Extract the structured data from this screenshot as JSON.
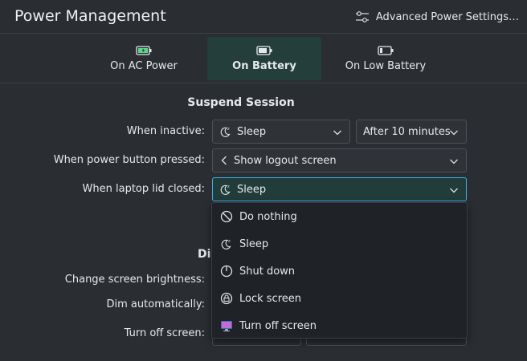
{
  "header": {
    "title": "Power Management",
    "advanced_label": "Advanced Power Settings…"
  },
  "tabs": [
    {
      "label": "On AC Power",
      "icon": "battery-charging-icon"
    },
    {
      "label": "On Battery",
      "icon": "battery-icon",
      "active": true
    },
    {
      "label": "On Low Battery",
      "icon": "battery-low-icon"
    }
  ],
  "suspend": {
    "section_title": "Suspend Session",
    "when_inactive_label": "When inactive:",
    "when_inactive_value": "Sleep",
    "after_value": "After 10 minutes",
    "power_button_label": "When power button pressed:",
    "power_button_value": "Show logout screen",
    "lid_label": "When laptop lid closed:",
    "lid_value": "Sleep"
  },
  "dropdown": {
    "options": [
      "Do nothing",
      "Sleep",
      "Shut down",
      "Lock screen",
      "Turn off screen"
    ]
  },
  "display": {
    "section_title_partial": "Di",
    "brightness_label": "Change screen brightness:",
    "dim_label": "Dim automatically:",
    "turn_off_label": "Turn off screen:"
  },
  "colors": {
    "accent": "#3daee9",
    "background": "#2a2e32",
    "active_tab": "#243e3c"
  }
}
